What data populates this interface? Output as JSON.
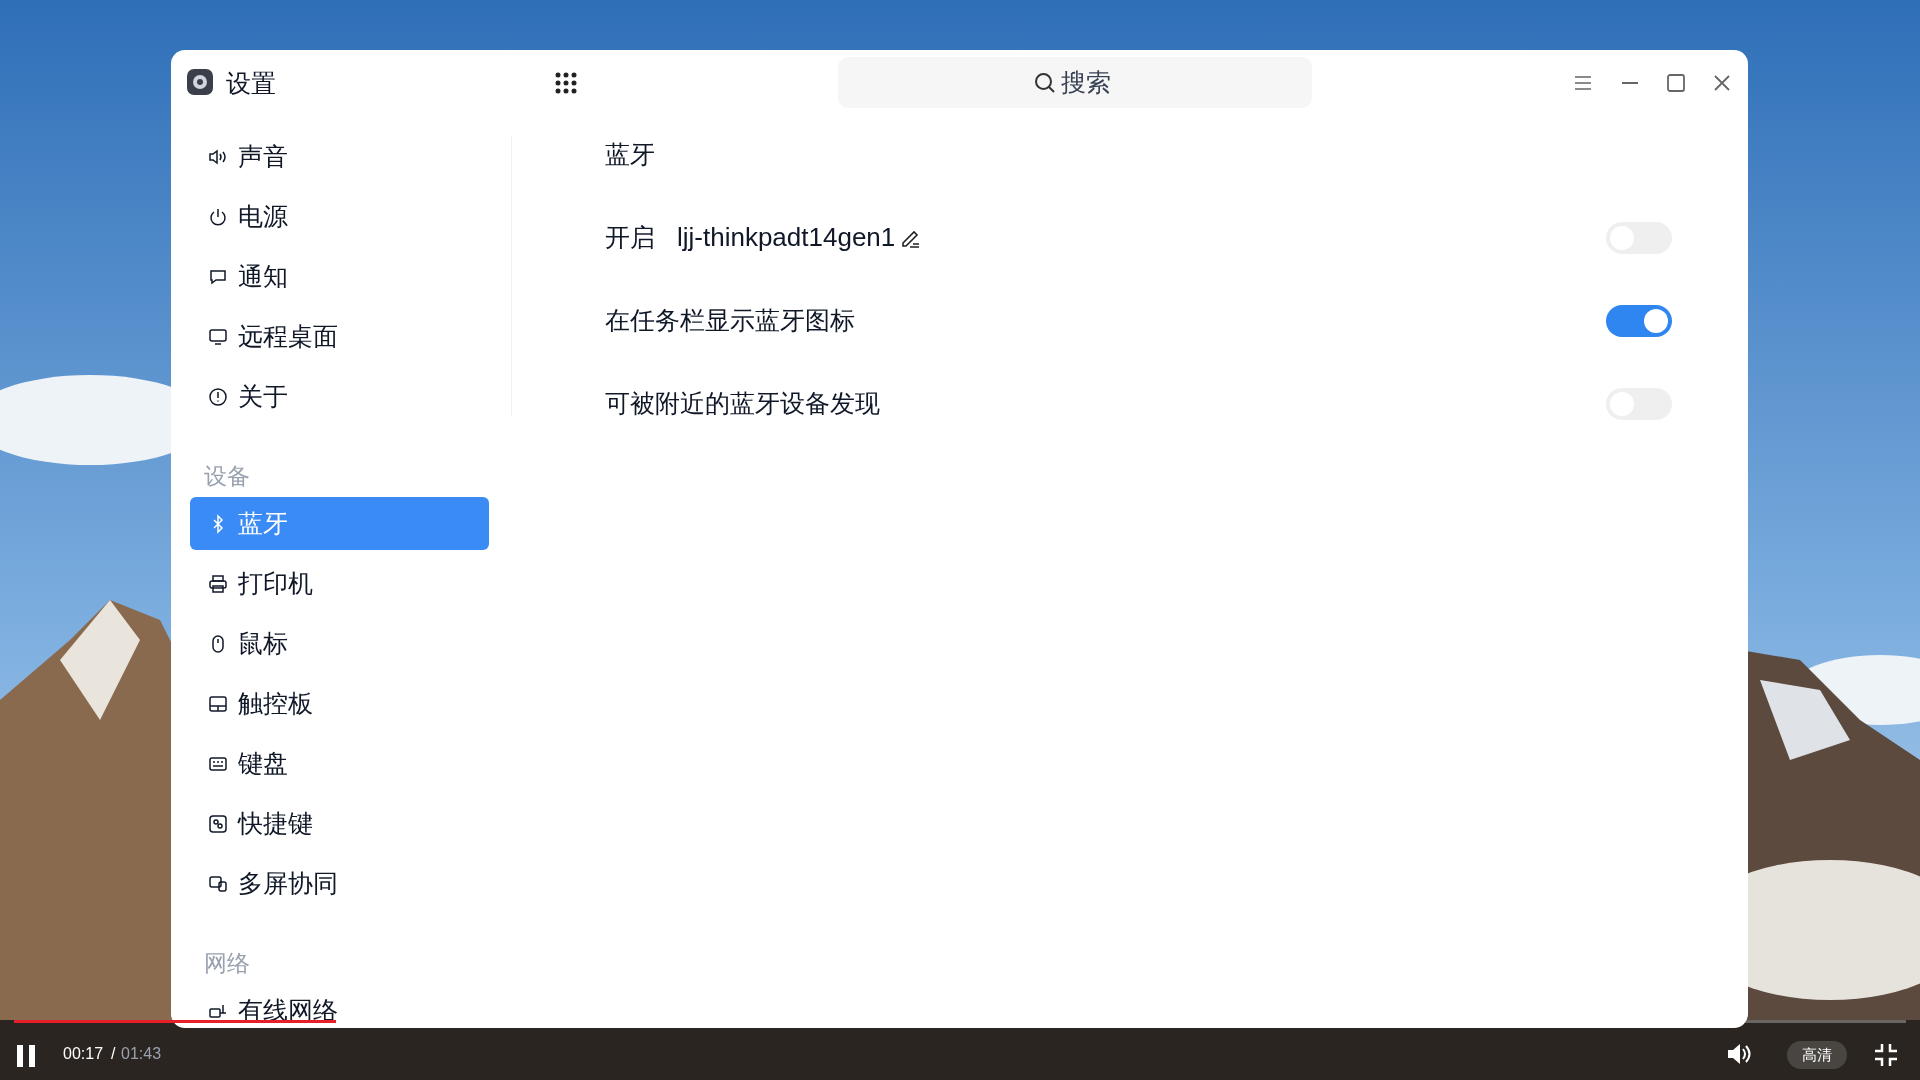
{
  "window": {
    "title": "设置",
    "search": {
      "placeholder": "搜索"
    }
  },
  "sidebar": {
    "sections": [
      {
        "items": [
          {
            "label": "声音",
            "selected": false
          },
          {
            "label": "电源",
            "selected": false
          },
          {
            "label": "通知",
            "selected": false
          },
          {
            "label": "远程桌面",
            "selected": false
          },
          {
            "label": "关于",
            "selected": false
          }
        ]
      },
      {
        "header": "设备",
        "items": [
          {
            "label": "蓝牙",
            "selected": true
          },
          {
            "label": "打印机",
            "selected": false
          },
          {
            "label": "鼠标",
            "selected": false
          },
          {
            "label": "触控板",
            "selected": false
          },
          {
            "label": "键盘",
            "selected": false
          },
          {
            "label": "快捷键",
            "selected": false
          },
          {
            "label": "多屏协同",
            "selected": false
          }
        ]
      },
      {
        "header": "网络",
        "items": [
          {
            "label": "有线网络",
            "selected": false
          }
        ]
      }
    ]
  },
  "content": {
    "title": "蓝牙",
    "settings": [
      {
        "label": "开启",
        "value": "ljj-thinkpadt14gen1",
        "on": false
      },
      {
        "label": "在任务栏显示蓝牙图标",
        "on": true
      },
      {
        "label": "可被附近的蓝牙设备发现",
        "on": false
      }
    ]
  },
  "player": {
    "playing": true,
    "level": 0.17,
    "current_time": "00:17",
    "separator": "/",
    "duration": "01:43",
    "quality": "高清"
  }
}
